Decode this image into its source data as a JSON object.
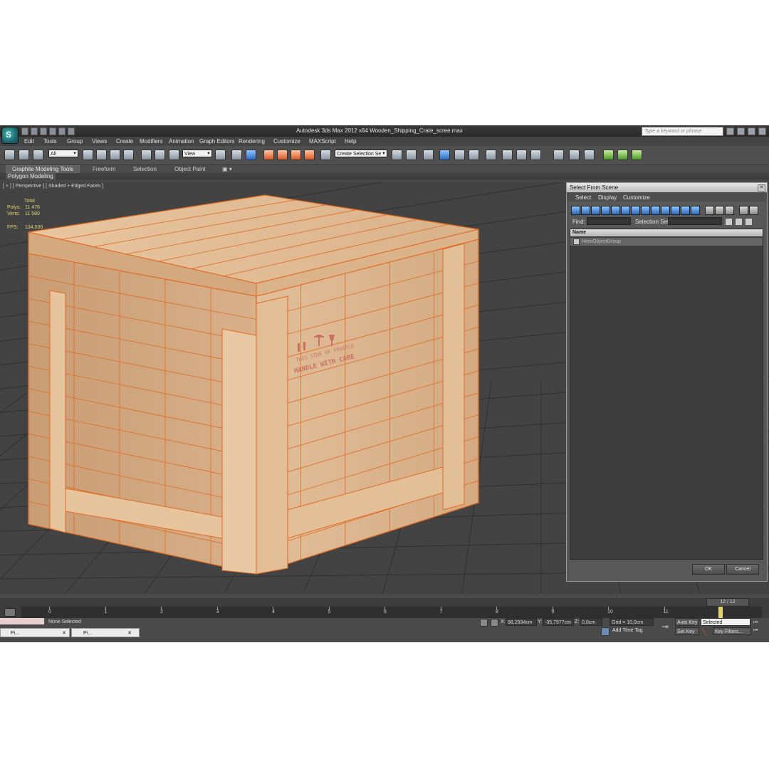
{
  "window": {
    "title": "Autodesk 3ds Max  2012 x64     Wooden_Shipping_Crate_scree.max",
    "search_placeholder": "Type a keyword or phrase",
    "logo": "3ds-max-logo-icon"
  },
  "menu": [
    "Edit",
    "Tools",
    "Group",
    "Views",
    "Create",
    "Modifiers",
    "Animation",
    "Graph Editors",
    "Rendering",
    "Customize",
    "MAXScript",
    "Help"
  ],
  "toolbar": {
    "filter_value": "All",
    "coord_value": "View",
    "selection_set_value": "Create Selection Se"
  },
  "ribbon": {
    "tabs": [
      "Graphite Modeling Tools",
      "Freeform",
      "Selection",
      "Object Paint"
    ],
    "panel_label": "Polygon Modeling"
  },
  "viewport": {
    "label": "[ + ] [ Perspective ] [ Shaded + Edged Faces ]",
    "stats_header": "Total",
    "polys_label": "Polys:",
    "polys_value": "11 476",
    "verts_label": "Verts:",
    "verts_value": "11 580",
    "fps_label": "FPS:",
    "fps_value": "134,036",
    "crate_text_1": "THIS SIDE UP FRAGILE",
    "crate_text_2": "HANDLE WITH CARE"
  },
  "dialog": {
    "title": "Select From Scene",
    "menu": [
      "Select",
      "Display",
      "Customize"
    ],
    "find_label": "Find:",
    "selection_set_label": "Selection Set:",
    "column_name": "Name",
    "items": [
      "HeroObjectGroup"
    ],
    "ok_label": "OK",
    "cancel_label": "Cancel"
  },
  "timeline": {
    "frame_display": "12 / 12",
    "ticks": [
      "0",
      "1",
      "2",
      "3",
      "4",
      "5",
      "6",
      "7",
      "8",
      "9",
      "10",
      "11"
    ],
    "current_frame": 12
  },
  "status": {
    "selection_text": "None Selected",
    "x_label": "X:",
    "x_value": "88,2934cm",
    "y_label": "Y:",
    "y_value": "-35,7577cm",
    "z_label": "Z:",
    "z_value": "0,0cm",
    "grid": "Grid = 10,0cm",
    "add_time_tag": "Add Time Tag",
    "auto_key": "Auto Key",
    "set_key": "Set Key",
    "key_mode_value": "Selected",
    "key_filters": "Key Filters...",
    "task_1": "Pi...",
    "task_2": "Pi..."
  },
  "colors": {
    "wood": "#d9b28a",
    "wireframe": "#e2691f",
    "viewport_bg": "#434343",
    "stats_text": "#e3d36f"
  }
}
